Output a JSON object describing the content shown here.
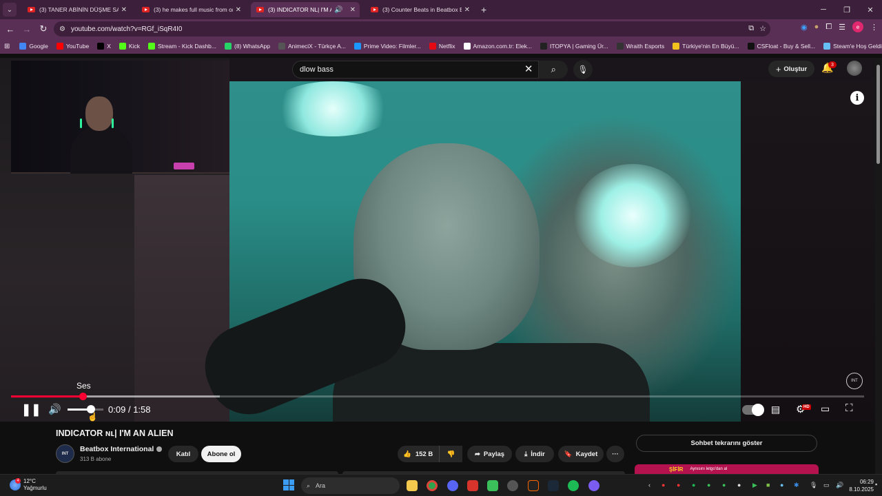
{
  "browser": {
    "tabs": [
      {
        "title": "(3) TANER ABİNİN DÜŞME SAHN",
        "active": false
      },
      {
        "title": "(3) he makes full music from on",
        "active": false
      },
      {
        "title": "(3) INDICATOR NL| I'M AN A",
        "active": true
      },
      {
        "title": "(3) Counter Beats in Beatbox Ba",
        "active": false
      }
    ],
    "url": "youtube.com/watch?v=RGf_iSqR4I0",
    "bookmarks": [
      {
        "label": "Google",
        "color": "#4285f4"
      },
      {
        "label": "YouTube",
        "color": "#ff0000"
      },
      {
        "label": "X",
        "color": "#000000"
      },
      {
        "label": "Kick",
        "color": "#53fc18"
      },
      {
        "label": "Stream - Kick Dashb...",
        "color": "#53fc18"
      },
      {
        "label": "(8) WhatsApp",
        "color": "#25d366"
      },
      {
        "label": "AnimeciX - Türkçe A...",
        "color": "#555555"
      },
      {
        "label": "Prime Video: Filmler...",
        "color": "#1a98ff"
      },
      {
        "label": "Netflix",
        "color": "#e50914"
      },
      {
        "label": "Amazon.com.tr: Elek...",
        "color": "#ffffff"
      },
      {
        "label": "ITOPYA | Gaming Ür...",
        "color": "#222222"
      },
      {
        "label": "Wraith Esports",
        "color": "#333333"
      },
      {
        "label": "Türkiye'nin En Büyü...",
        "color": "#f4c21d"
      },
      {
        "label": "CSFloat - Buy & Sell...",
        "color": "#111111"
      },
      {
        "label": "Steam'e Hoş Geldiniz",
        "color": "#66c0f4"
      }
    ],
    "profile_initial": "e"
  },
  "youtube": {
    "search_query": "dlow bass",
    "create_label": "Oluştur",
    "notification_count": "3",
    "player": {
      "tooltip": "Ses",
      "time_current": "0:09",
      "time_separator": "/",
      "time_total": "1:58",
      "progress_fraction": 0.084,
      "buffered_fraction": 0.245,
      "volume_fraction": 0.65,
      "watermark": "INT"
    },
    "video_title": "INDICATOR ɴʟ| I'M AN ALIEN",
    "channel": {
      "avatar_text": "INT",
      "name": "Beatbox International",
      "subscribers": "313 B abone",
      "join_label": "Katıl",
      "subscribe_label": "Abone ol"
    },
    "actions": {
      "likes": "152 B",
      "share": "Paylaş",
      "download": "İndir",
      "save": "Kaydet",
      "more": "···"
    },
    "chat_replay": "Sohbet tekrarını göster",
    "ad": {
      "brand": "ŞİFİR",
      "text": "Aynısını letgo'dan al"
    }
  },
  "taskbar": {
    "weather_temp": "12°C",
    "weather_desc": "Yağmurlu",
    "weather_badge": "4",
    "search_placeholder": "Ara",
    "time": "06:29",
    "date": "8.10.2025"
  },
  "colors": {
    "accent_red": "#ff0033",
    "tab_bar": "#3c1f3a",
    "toolbar": "#5a2f55"
  }
}
